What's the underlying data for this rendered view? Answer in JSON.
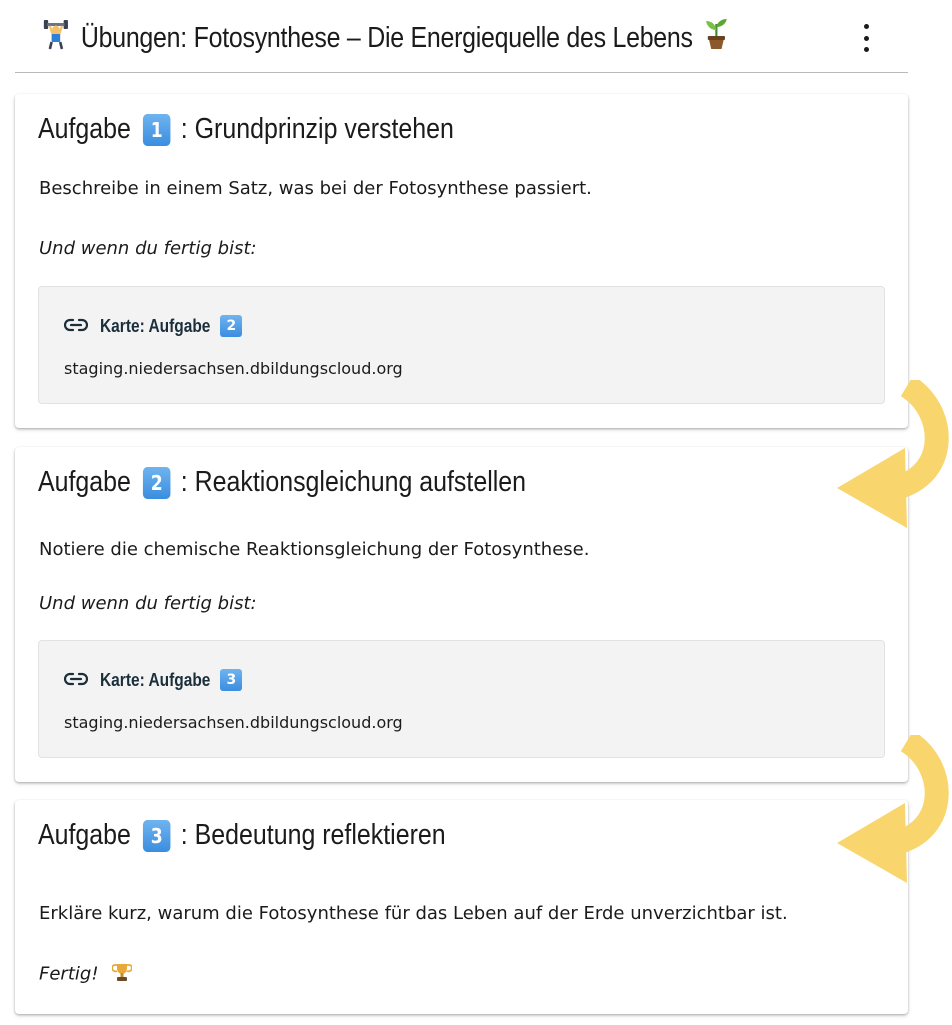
{
  "header": {
    "title": "Übungen: Fotosynthese – Die Energiequelle des Lebens",
    "leading_icon": "weightlifter-icon",
    "trailing_icon": "seedling-icon",
    "menu_icon": "kebab-menu-icon"
  },
  "cards": [
    {
      "title_prefix": "Aufgabe",
      "number": "1",
      "title_suffix": ": Grundprinzip verstehen",
      "text": "Beschreibe in einem Satz, was bei der Fotosynthese passiert.",
      "followup": "Und wenn du fertig bist:",
      "link": {
        "label": "Karte: Aufgabe",
        "number": "2",
        "url": "staging.niedersachsen.dbildungscloud.org",
        "icon": "link-icon"
      }
    },
    {
      "title_prefix": "Aufgabe",
      "number": "2",
      "title_suffix": ": Reaktionsgleichung aufstellen",
      "text": "Notiere die chemische Reaktionsgleichung der Fotosynthese.",
      "followup": "Und wenn du fertig bist:",
      "link": {
        "label": "Karte: Aufgabe",
        "number": "3",
        "url": "staging.niedersachsen.dbildungscloud.org",
        "icon": "link-icon"
      }
    },
    {
      "title_prefix": "Aufgabe",
      "number": "3",
      "title_suffix": ": Bedeutung reflektieren",
      "text": "Erkläre kurz, warum die Fotosynthese für das Leben auf der Erde unverzichtbar ist.",
      "followup": "Fertig!",
      "followup_icon": "trophy-icon"
    }
  ],
  "colors": {
    "arrow": "#f9d56e",
    "badge": "#3a8de0",
    "link_box_bg": "#f3f3f4"
  }
}
